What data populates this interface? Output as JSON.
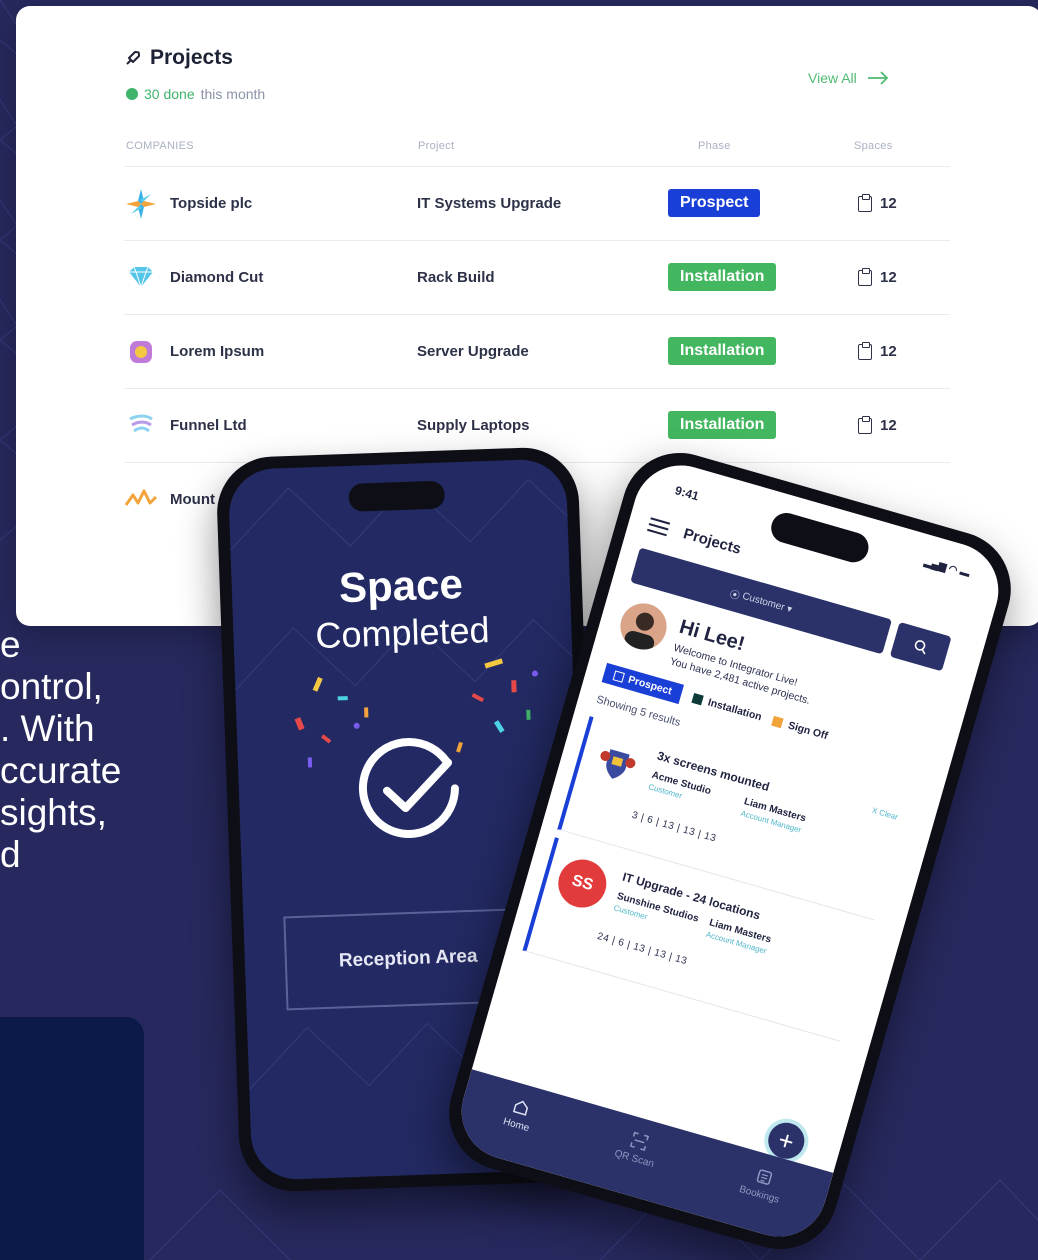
{
  "bg_text_lines": [
    "e",
    "ontrol,",
    ". With",
    "ccurate",
    "sights,",
    "d"
  ],
  "projects_card": {
    "title": "Projects",
    "subtitle_count": "30 done",
    "subtitle_rest": "this month",
    "view_all": "View All",
    "columns": [
      "COMPANIES",
      "Project",
      "Phase",
      "Spaces"
    ],
    "rows": [
      {
        "company": "Topside plc",
        "project": "IT Systems Upgrade",
        "phase": "Prospect",
        "spaces": "12"
      },
      {
        "company": "Diamond Cut",
        "project": "Rack Build",
        "phase": "Installation",
        "spaces": "12"
      },
      {
        "company": "Lorem Ipsum",
        "project": "Server Upgrade",
        "phase": "Installation",
        "spaces": "12"
      },
      {
        "company": "Funnel Ltd",
        "project": "Supply Laptops",
        "phase": "Installation",
        "spaces": "12"
      },
      {
        "company": "Mount S",
        "project": "",
        "phase": "",
        "spaces": ""
      }
    ],
    "colors": {
      "prospect": "#1a3fd6",
      "installation": "#43b660",
      "accent_green": "#3fb56b"
    }
  },
  "phone_left": {
    "title": "Space",
    "subtitle": "Completed",
    "area_label": "Reception Area"
  },
  "phone_right": {
    "time": "9:41",
    "app_title": "Projects",
    "customer_select": "Customer",
    "greeting": "Hi Lee!",
    "welcome_line1": "Welcome to Integrator Live!",
    "welcome_line2": "You have 2,481 active projects.",
    "legend": [
      "Prospect",
      "Installation",
      "Sign Off"
    ],
    "showing": "Showing 5 results",
    "clear": "X Clear",
    "projects": [
      {
        "title": "3x screens mounted",
        "customer": "Acme Studio",
        "customer_role": "Customer",
        "manager": "Liam Masters",
        "manager_role": "Account Manager",
        "stats": "3 | 6 | 13 | 13 | 13",
        "badge_text": ""
      },
      {
        "title": "IT Upgrade - 24 locations",
        "customer": "Sunshine Studios",
        "customer_role": "Customer",
        "manager": "Liam Masters",
        "manager_role": "Account Manager",
        "stats": "24 | 6 | 13 | 13 | 13",
        "badge_text": "SS"
      }
    ],
    "tabs": [
      "Home",
      "QR Scan",
      "Bookings"
    ]
  }
}
